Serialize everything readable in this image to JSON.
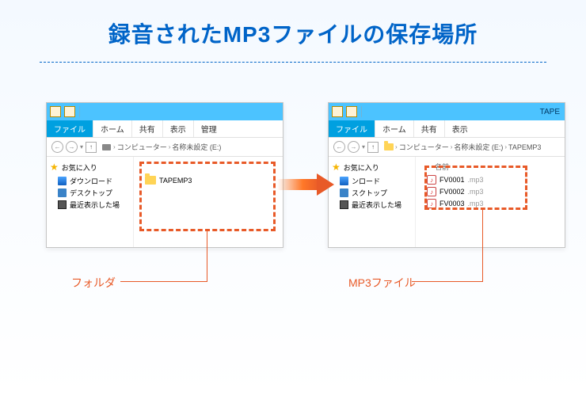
{
  "title": "録音されたMP3ファイルの保存場所",
  "win_left": {
    "hdr_title": "",
    "tabs": {
      "file": "ファイル",
      "home": "ホーム",
      "share": "共有",
      "view": "表示",
      "manage": "管理"
    },
    "crumb": {
      "computer": "コンピューター",
      "drive": "名称未設定 (E:)"
    },
    "sidebar": {
      "fav": "お気に入り",
      "dl": "ダウンロード",
      "desk": "デスクトップ",
      "recent": "最近表示した場"
    },
    "folder": "TAPEMP3"
  },
  "win_right": {
    "hdr_title": "TAPE",
    "tabs": {
      "file": "ファイル",
      "home": "ホーム",
      "share": "共有",
      "view": "表示"
    },
    "crumb": {
      "computer": "コンピューター",
      "drive": "名称未設定 (E:)",
      "folder": "TAPEMP3"
    },
    "sidebar": {
      "fav": "お気に入り",
      "dl": "ンロード",
      "desk": "スクトップ",
      "recent": "最近表示した場"
    },
    "col_name": "名前",
    "files": [
      {
        "name": "FV0001",
        "ext": ".mp3"
      },
      {
        "name": "FV0002",
        "ext": ".mp3"
      },
      {
        "name": "FV0003",
        "ext": ".mp3"
      }
    ]
  },
  "caption_left": "フォルダ",
  "caption_right": "MP3ファイル"
}
